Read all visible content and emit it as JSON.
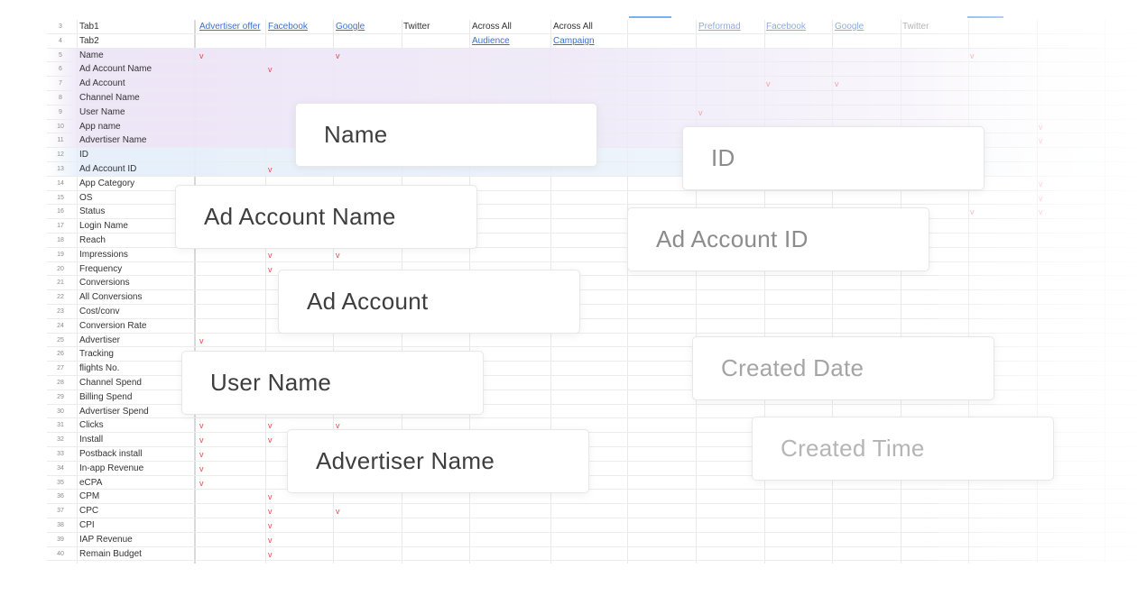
{
  "sheet": {
    "header_rows": [
      {
        "num": "3",
        "label": "Tab1",
        "cells": [
          {
            "text": "Advertiser offer",
            "link": true
          },
          {
            "text": "Facebook",
            "link": true
          },
          {
            "text": "Google",
            "link": true
          },
          {
            "text": "Twitter",
            "link": false
          },
          {
            "text": "Across All",
            "link": false
          },
          {
            "text": "Across All",
            "link": false
          },
          {
            "text": "",
            "link": false
          },
          {
            "text": "Preformad",
            "link": true
          },
          {
            "text": "Facebook",
            "link": true
          },
          {
            "text": "Google",
            "link": true
          },
          {
            "text": "Twitter",
            "link": false
          }
        ]
      },
      {
        "num": "4",
        "label": "Tab2",
        "cells": [
          {
            "text": "",
            "link": false
          },
          {
            "text": "",
            "link": false
          },
          {
            "text": "",
            "link": false
          },
          {
            "text": "",
            "link": false
          },
          {
            "text": "Audience",
            "link": true
          },
          {
            "text": "Campaign",
            "link": true
          }
        ]
      }
    ],
    "rows": [
      {
        "num": "5",
        "label": "Name",
        "marks": [
          0,
          2
        ],
        "faint_marks": [
          11
        ],
        "band": "purple"
      },
      {
        "num": "6",
        "label": "Ad Account Name",
        "marks": [
          1
        ],
        "faint_marks": [],
        "band": "purple"
      },
      {
        "num": "7",
        "label": "Ad Account",
        "marks": [],
        "faint_marks": [
          8,
          9
        ],
        "band": "purple"
      },
      {
        "num": "8",
        "label": "Channel Name",
        "marks": [],
        "faint_marks": [],
        "band": "purple"
      },
      {
        "num": "9",
        "label": "User Name",
        "marks": [],
        "faint_marks": [
          7
        ],
        "band": "purple"
      },
      {
        "num": "10",
        "label": "App name",
        "marks": [],
        "faint_marks": [
          12
        ],
        "band": "purple"
      },
      {
        "num": "11",
        "label": "Advertiser Name",
        "marks": [],
        "faint_marks": [
          12
        ],
        "band": "purple"
      },
      {
        "num": "12",
        "label": "ID",
        "marks": [],
        "faint_marks": [],
        "band": "blue"
      },
      {
        "num": "13",
        "label": "Ad Account ID",
        "marks": [
          1
        ],
        "faint_marks": [],
        "band": "blue"
      },
      {
        "num": "14",
        "label": "App Category",
        "marks": [],
        "faint_marks": [
          12
        ],
        "band": ""
      },
      {
        "num": "15",
        "label": "OS",
        "marks": [],
        "faint_marks": [
          12
        ],
        "band": ""
      },
      {
        "num": "16",
        "label": "Status",
        "marks": [],
        "faint_marks": [
          11,
          12
        ],
        "band": ""
      },
      {
        "num": "17",
        "label": "Login Name",
        "marks": [],
        "faint_marks": [],
        "band": ""
      },
      {
        "num": "18",
        "label": "Reach",
        "marks": [],
        "faint_marks": [],
        "band": ""
      },
      {
        "num": "19",
        "label": "Impressions",
        "marks": [
          1,
          2
        ],
        "faint_marks": [],
        "band": ""
      },
      {
        "num": "20",
        "label": "Frequency",
        "marks": [
          1
        ],
        "faint_marks": [],
        "band": ""
      },
      {
        "num": "21",
        "label": "Conversions",
        "marks": [],
        "faint_marks": [],
        "band": ""
      },
      {
        "num": "22",
        "label": "All Conversions",
        "marks": [],
        "faint_marks": [],
        "band": ""
      },
      {
        "num": "23",
        "label": "Cost/conv",
        "marks": [],
        "faint_marks": [],
        "band": ""
      },
      {
        "num": "24",
        "label": "Conversion Rate",
        "marks": [],
        "faint_marks": [],
        "band": ""
      },
      {
        "num": "25",
        "label": "Advertiser",
        "marks": [
          0
        ],
        "faint_marks": [],
        "band": ""
      },
      {
        "num": "26",
        "label": "Tracking",
        "marks": [],
        "faint_marks": [],
        "band": ""
      },
      {
        "num": "27",
        "label": "flights No.",
        "marks": [],
        "faint_marks": [],
        "band": ""
      },
      {
        "num": "28",
        "label": "Channel Spend",
        "marks": [],
        "faint_marks": [],
        "band": ""
      },
      {
        "num": "29",
        "label": "Billing Spend",
        "marks": [],
        "faint_marks": [],
        "band": ""
      },
      {
        "num": "30",
        "label": "Advertiser Spend",
        "marks": [],
        "faint_marks": [],
        "band": ""
      },
      {
        "num": "31",
        "label": "Clicks",
        "marks": [
          0,
          1,
          2
        ],
        "faint_marks": [],
        "band": ""
      },
      {
        "num": "32",
        "label": "Install",
        "marks": [
          0,
          1
        ],
        "faint_marks": [],
        "band": ""
      },
      {
        "num": "33",
        "label": "Postback install",
        "marks": [
          0
        ],
        "faint_marks": [],
        "band": ""
      },
      {
        "num": "34",
        "label": "In-app Revenue",
        "marks": [
          0
        ],
        "faint_marks": [],
        "band": ""
      },
      {
        "num": "35",
        "label": "eCPA",
        "marks": [
          0
        ],
        "faint_marks": [],
        "band": ""
      },
      {
        "num": "36",
        "label": "CPM",
        "marks": [
          1
        ],
        "faint_marks": [],
        "band": ""
      },
      {
        "num": "37",
        "label": "CPC",
        "marks": [
          1,
          2
        ],
        "faint_marks": [],
        "band": ""
      },
      {
        "num": "38",
        "label": "CPI",
        "marks": [
          1
        ],
        "faint_marks": [],
        "band": ""
      },
      {
        "num": "39",
        "label": "IAP Revenue",
        "marks": [
          1
        ],
        "faint_marks": [],
        "band": ""
      },
      {
        "num": "40",
        "label": "Remain Budget",
        "marks": [
          1
        ],
        "faint_marks": [],
        "band": ""
      }
    ],
    "mark_char": "v"
  },
  "cards": [
    {
      "id": "name",
      "label": "Name",
      "tone": "dark"
    },
    {
      "id": "id",
      "label": "ID",
      "tone": "light"
    },
    {
      "id": "ad-account-name",
      "label": "Ad Account Name",
      "tone": "dark"
    },
    {
      "id": "ad-account-id",
      "label": "Ad Account ID",
      "tone": "light"
    },
    {
      "id": "ad-account",
      "label": "Ad Account",
      "tone": "dark"
    },
    {
      "id": "created-date",
      "label": "Created Date",
      "tone": "lighter"
    },
    {
      "id": "user-name",
      "label": "User Name",
      "tone": "dark"
    },
    {
      "id": "created-time",
      "label": "Created Time",
      "tone": "lightest"
    },
    {
      "id": "advertiser-name",
      "label": "Advertiser Name",
      "tone": "dark"
    }
  ]
}
